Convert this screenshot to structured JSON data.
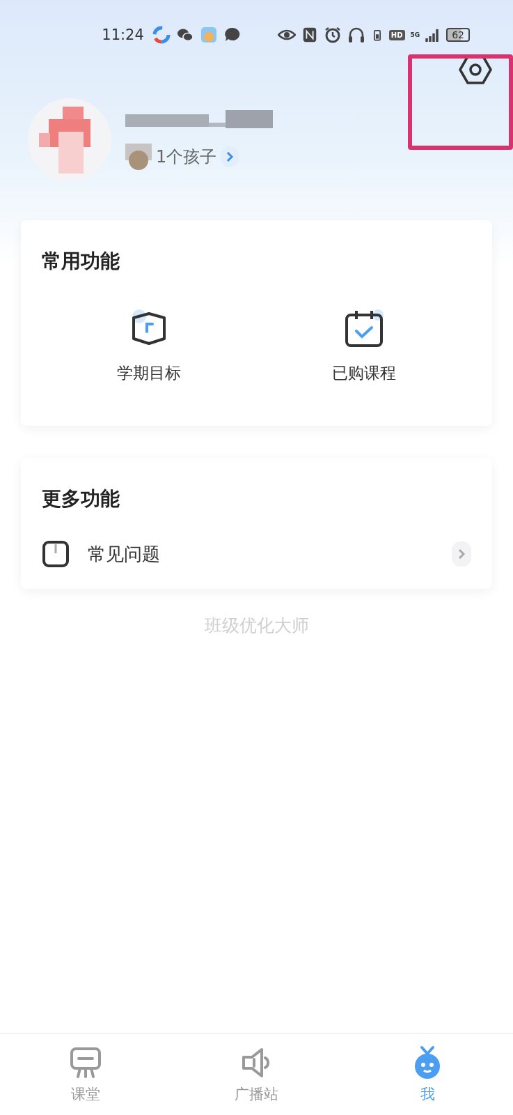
{
  "status_bar": {
    "time": "11:24",
    "network": "5G",
    "hd": "HD",
    "battery": "62"
  },
  "profile": {
    "child_count": "1个孩子"
  },
  "common": {
    "title": "常用功能",
    "items": [
      {
        "kind": "goal",
        "label": "学期目标"
      },
      {
        "kind": "course",
        "label": "已购课程"
      }
    ]
  },
  "more": {
    "title": "更多功能",
    "items": [
      {
        "kind": "faq",
        "label": "常见问题"
      }
    ]
  },
  "footer": "班级优化大师",
  "tabs": [
    {
      "kind": "classroom",
      "label": "课堂",
      "selected": false
    },
    {
      "kind": "broadcast",
      "label": "广播站",
      "selected": false
    },
    {
      "kind": "me",
      "label": "我",
      "selected": true
    }
  ]
}
